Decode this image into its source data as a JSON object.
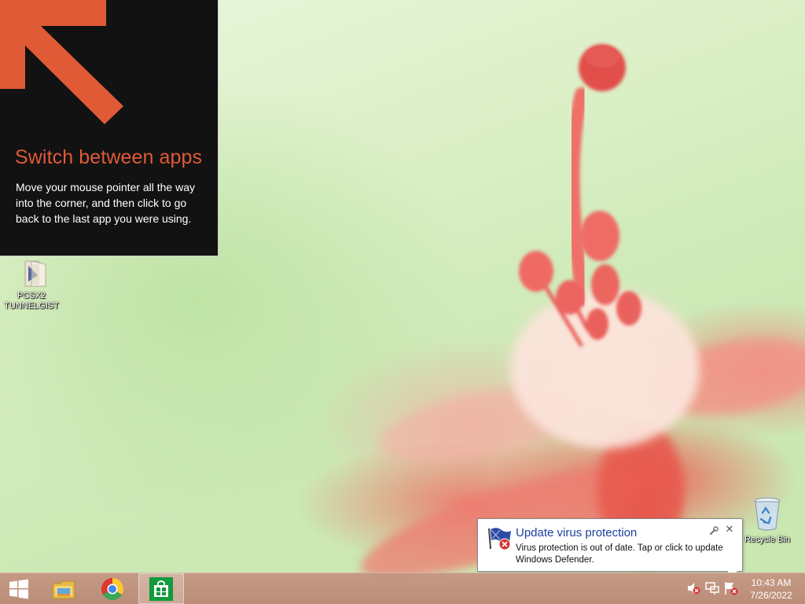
{
  "tip": {
    "title": "Switch between apps",
    "body": "Move your mouse pointer all the way into the corner, and then click to go back to the last app you were using.",
    "accent_color": "#e05a36",
    "background_color": "#121212"
  },
  "desktop_icons": [
    {
      "label_line1": "PCSX2",
      "label_line2": "TUNNELGIST",
      "icon": "folder-with-file-icon"
    },
    {
      "label": "Recycle Bin",
      "icon": "recycle-bin-icon"
    }
  ],
  "notification": {
    "title": "Update virus protection",
    "text": "Virus protection is out of date. Tap or click to update Windows Defender.",
    "icon": "defender-flag-error-icon",
    "settings_icon": "wrench-icon",
    "close_glyph": "✕"
  },
  "taskbar": {
    "start_icon": "windows-logo-icon",
    "pinned": [
      {
        "name": "File Explorer",
        "icon": "file-explorer-icon"
      },
      {
        "name": "Google Chrome",
        "icon": "chrome-icon"
      },
      {
        "name": "Store",
        "icon": "store-icon"
      }
    ],
    "tray": [
      {
        "name": "Volume muted",
        "icon": "volume-muted-icon"
      },
      {
        "name": "Network",
        "icon": "network-icon"
      },
      {
        "name": "Action Center",
        "icon": "action-center-flag-icon"
      }
    ],
    "clock": {
      "time": "10:43 AM",
      "date": "7/26/2022"
    }
  }
}
